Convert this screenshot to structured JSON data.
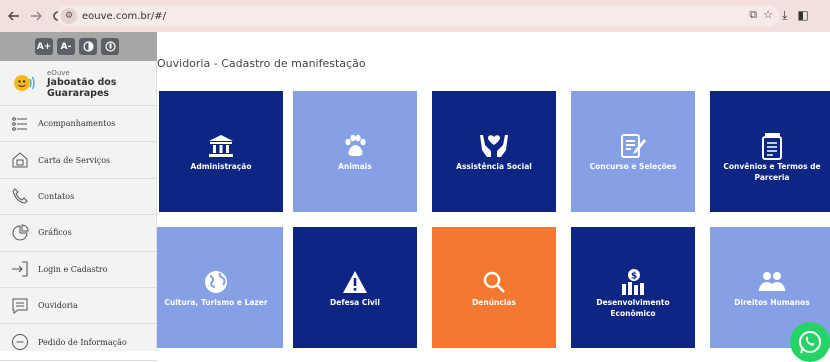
{
  "browser": {
    "url": "eouve.com.br/#/",
    "back_icon": "back-arrow-icon",
    "forward_icon": "forward-arrow-icon",
    "reload_icon": "reload-icon"
  },
  "accessibility": {
    "increase_font": "A+",
    "decrease_font": "A-"
  },
  "brand": {
    "small": "eOuve",
    "name": "Jaboatão dos Guararapes"
  },
  "sidebar": {
    "items": [
      {
        "label": "Acompanhamentos",
        "icon": "list-icon"
      },
      {
        "label": "Carta de Serviços",
        "icon": "services-icon"
      },
      {
        "label": "Contatos",
        "icon": "phone-icon"
      },
      {
        "label": "Gráficos",
        "icon": "pie-chart-icon"
      },
      {
        "label": "Login e Cadastro",
        "icon": "login-icon"
      },
      {
        "label": "Ouvidoria",
        "icon": "chat-icon"
      },
      {
        "label": "Pedido de Informação",
        "icon": "info-bubble-icon"
      }
    ]
  },
  "main": {
    "title": "Ouvidoria - Cadastro de manifestação",
    "tiles": [
      {
        "label": "Administração",
        "style": "dark",
        "icon": "building-icon"
      },
      {
        "label": "Animais",
        "style": "light",
        "icon": "paw-icon"
      },
      {
        "label": "Assistência Social",
        "style": "dark",
        "icon": "helping-hands-icon"
      },
      {
        "label": "Concurso e Seleções",
        "style": "light",
        "icon": "form-icon"
      },
      {
        "label": "Convênios e Termos de Parceria",
        "style": "dark",
        "icon": "documents-icon"
      },
      {
        "label": "Cultura, Turismo e Lazer",
        "style": "light",
        "icon": "globe-icon"
      },
      {
        "label": "Defesa Civil",
        "style": "dark",
        "icon": "warning-icon"
      },
      {
        "label": "Denúncias",
        "style": "orange",
        "icon": "search-icon"
      },
      {
        "label": "Desenvolvimento Econômico",
        "style": "dark",
        "icon": "money-chart-icon"
      },
      {
        "label": "Direitos Humanos",
        "style": "light",
        "icon": "people-icon"
      }
    ]
  },
  "colors": {
    "dark_tile": "#0e2683",
    "light_tile": "#86a0e6",
    "orange_tile": "#f47930"
  }
}
